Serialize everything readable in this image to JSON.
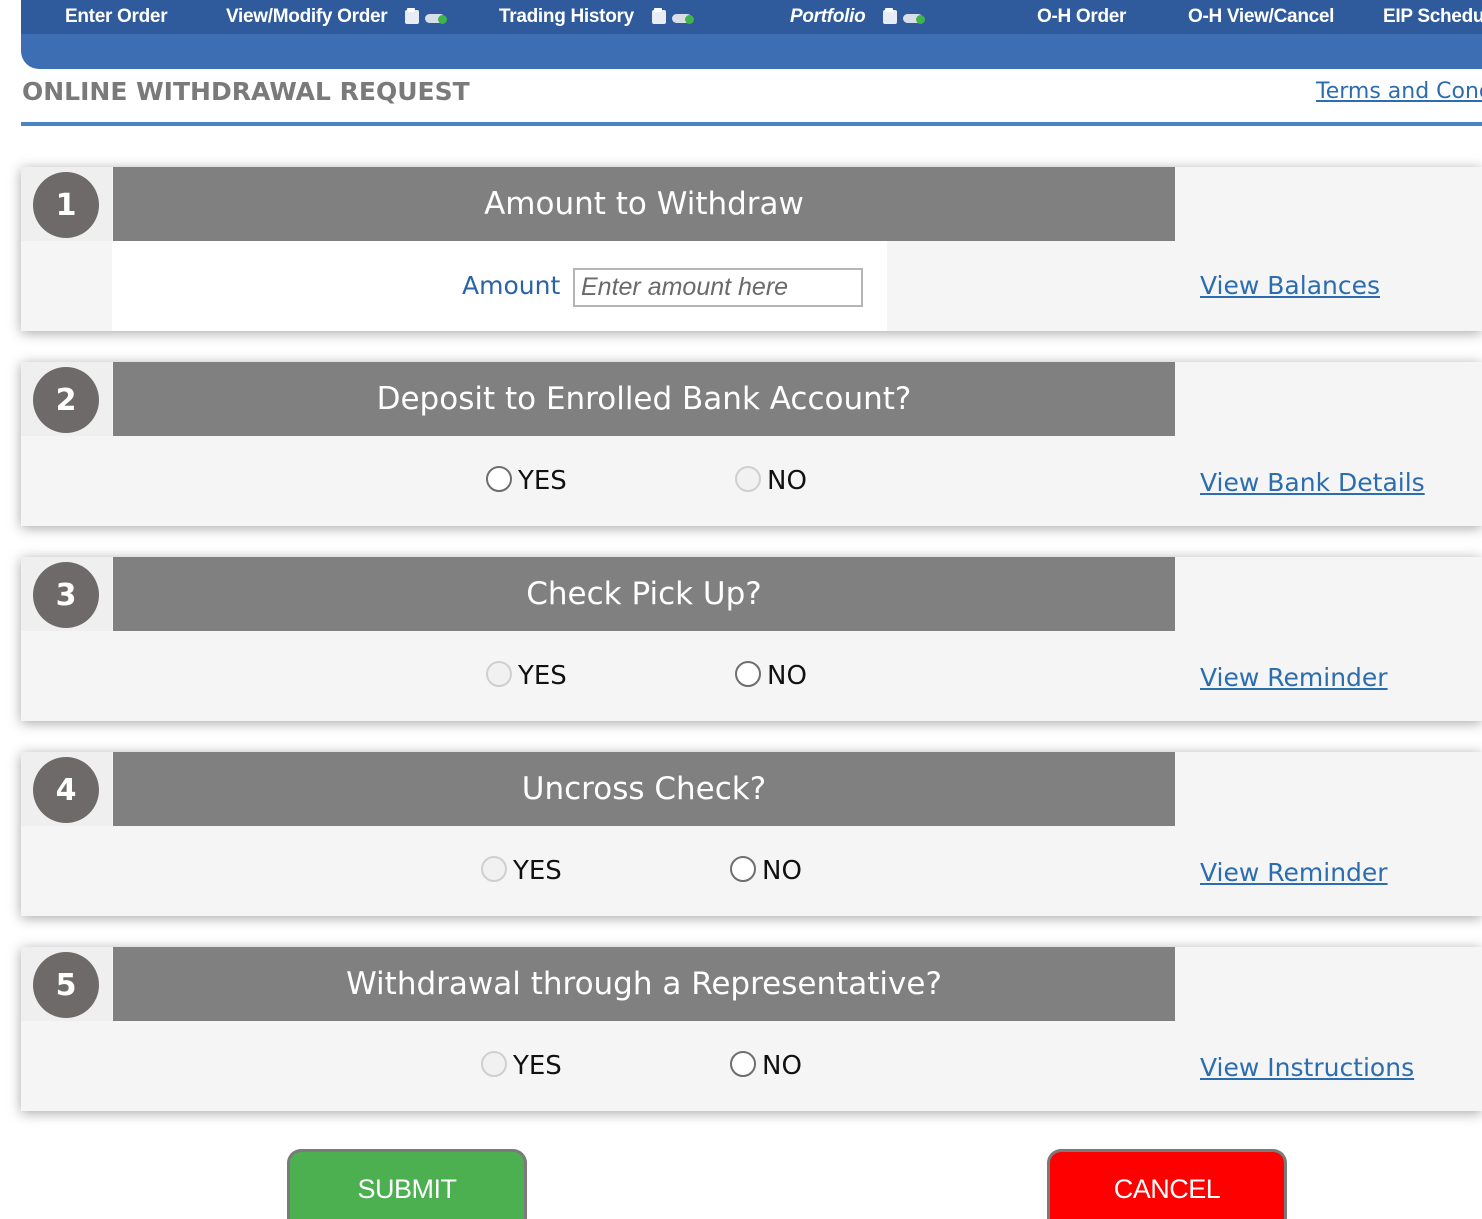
{
  "nav": {
    "items": [
      {
        "label": "Enter Order",
        "icons": false,
        "italic": false
      },
      {
        "label": "View/Modify Order",
        "icons": true,
        "italic": false
      },
      {
        "label": "Trading History",
        "icons": true,
        "italic": false
      },
      {
        "label": "Portfolio",
        "icons": true,
        "italic": true
      },
      {
        "label": "O-H Order",
        "icons": false,
        "italic": false
      },
      {
        "label": "O-H View/Cancel",
        "icons": false,
        "italic": false
      },
      {
        "label": "EIP Schedule",
        "icons": false,
        "italic": false
      }
    ],
    "icon_names": [
      "document-icon",
      "cloud-download-icon"
    ]
  },
  "header": {
    "title": "ONLINE WITHDRAWAL REQUEST",
    "terms_link": "Terms and Conditions"
  },
  "steps": [
    {
      "number": "1",
      "title": "Amount to Withdraw",
      "amount_label": "Amount",
      "amount_placeholder": "Enter amount here",
      "amount_value": "",
      "side_link": "View Balances"
    },
    {
      "number": "2",
      "title": "Deposit to Enrolled Bank Account?",
      "yes_label": "YES",
      "no_label": "NO",
      "yes_enabled": true,
      "no_enabled": false,
      "selected": null,
      "side_link": "View Bank Details"
    },
    {
      "number": "3",
      "title": "Check Pick Up?",
      "yes_label": "YES",
      "no_label": "NO",
      "yes_enabled": false,
      "no_enabled": true,
      "selected": null,
      "side_link": "View Reminder"
    },
    {
      "number": "4",
      "title": "Uncross Check?",
      "yes_label": "YES",
      "no_label": "NO",
      "yes_enabled": false,
      "no_enabled": true,
      "selected": null,
      "side_link": "View Reminder"
    },
    {
      "number": "5",
      "title": "Withdrawal through a Representative?",
      "yes_label": "YES",
      "no_label": "NO",
      "yes_enabled": false,
      "no_enabled": true,
      "selected": null,
      "side_link": "View Instructions"
    }
  ],
  "actions": {
    "submit_label": "SUBMIT",
    "cancel_label": "CANCEL"
  },
  "colors": {
    "nav_top": "#2f5a9c",
    "nav_bottom": "#3d6eb3",
    "link": "#2c6db0",
    "header_bar": "#808080",
    "submit": "#4caf50",
    "cancel": "#ff0000"
  }
}
